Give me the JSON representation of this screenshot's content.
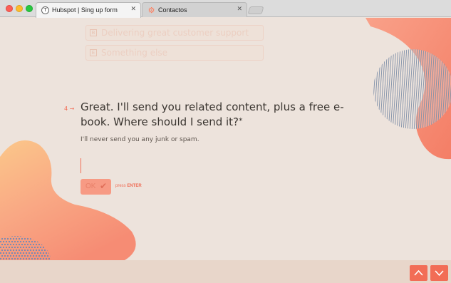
{
  "browser": {
    "tabs": [
      {
        "title": "Hubspot | Sing up form",
        "favicon": "T",
        "close": "✕",
        "active": true
      },
      {
        "title": "Contactos",
        "favicon": "hubspot-logo",
        "close": "✕",
        "active": false
      }
    ]
  },
  "form": {
    "previous_options": [
      {
        "key": "B",
        "label": "Delivering great customer support"
      },
      {
        "key": "E",
        "label": "Something else"
      }
    ],
    "question": {
      "number": "4 →",
      "title": "Great. I'll send you related content, plus a free e-book. Where should I send it?",
      "required_marker": "*",
      "description": "I'll never send you any junk or spam."
    },
    "answer": {
      "value": ""
    },
    "ok_button": {
      "label": "OK",
      "icon": "checkmark-icon"
    },
    "hint": {
      "prefix": "press",
      "key": "ENTER"
    }
  },
  "footer": {
    "nav_up_icon": "chevron-up-icon",
    "nav_down_icon": "chevron-down-icon"
  },
  "colors": {
    "accent": "#f26d56",
    "background": "#ede3dc",
    "text": "#3a3530",
    "footer": "#e8d6ca"
  }
}
